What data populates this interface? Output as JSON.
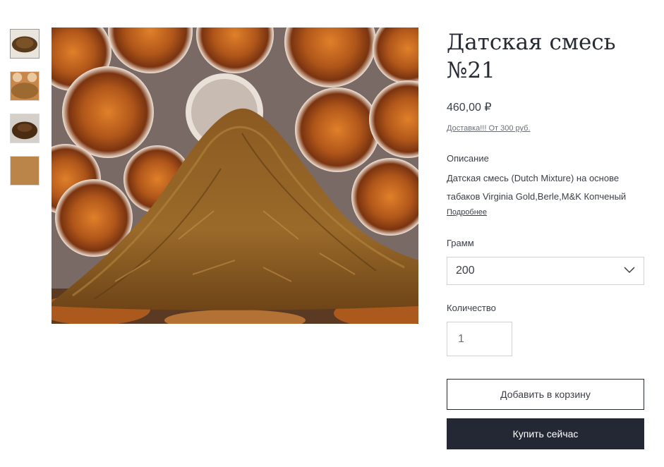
{
  "product": {
    "title": "Датская смесь №21",
    "price": "460,00 ₽",
    "delivery_link": "Доставка!!! От 300 руб.",
    "description_label": "Описание",
    "description_text": "Датская смесь (Dutch Mixture) на основе табаков Virginia Gold,Berle,M&K Копченый",
    "more_link": "Подробнее"
  },
  "options": {
    "gram_label": "Грамм",
    "gram_selected": "200",
    "quantity_label": "Количество",
    "quantity_value": "1"
  },
  "actions": {
    "add_to_cart": "Добавить в корзину",
    "buy_now": "Купить сейчас"
  },
  "colors": {
    "buy_button_bg": "#232834",
    "text": "#262b33"
  },
  "gallery": {
    "thumbnail_count": 4,
    "selected_index": 0
  }
}
